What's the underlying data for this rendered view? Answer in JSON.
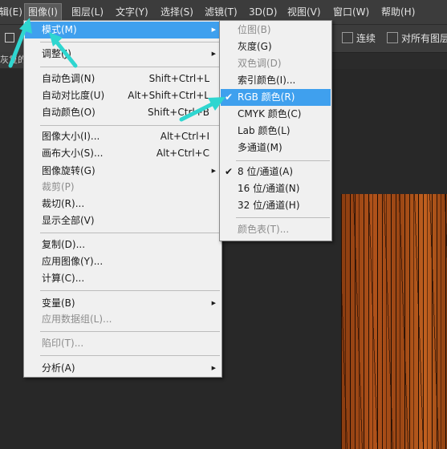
{
  "menubar": {
    "items": [
      {
        "label": "辑(E)"
      },
      {
        "label": "图像(I)"
      },
      {
        "label": "图层(L)"
      },
      {
        "label": "文字(Y)"
      },
      {
        "label": "选择(S)"
      },
      {
        "label": "滤镜(T)"
      },
      {
        "label": "3D(D)"
      },
      {
        "label": "视图(V)"
      },
      {
        "label": "窗口(W)"
      },
      {
        "label": "帮助(H)"
      }
    ]
  },
  "options": {
    "contiguous_label": "连续",
    "all_layers_label": "对所有图层"
  },
  "document": {
    "tab_text": "灰复的"
  },
  "image_menu": {
    "items": [
      {
        "label": "模式(M)",
        "has_submenu": true,
        "highlighted": true
      },
      {
        "label": "调整(J)",
        "has_submenu": true
      },
      {
        "label": "自动色调(N)",
        "shortcut": "Shift+Ctrl+L"
      },
      {
        "label": "自动对比度(U)",
        "shortcut": "Alt+Shift+Ctrl+L"
      },
      {
        "label": "自动颜色(O)",
        "shortcut": "Shift+Ctrl+B"
      },
      {
        "label": "图像大小(I)...",
        "shortcut": "Alt+Ctrl+I"
      },
      {
        "label": "画布大小(S)...",
        "shortcut": "Alt+Ctrl+C"
      },
      {
        "label": "图像旋转(G)",
        "has_submenu": true
      },
      {
        "label": "裁剪(P)",
        "disabled": true
      },
      {
        "label": "裁切(R)..."
      },
      {
        "label": "显示全部(V)"
      },
      {
        "label": "复制(D)..."
      },
      {
        "label": "应用图像(Y)..."
      },
      {
        "label": "计算(C)..."
      },
      {
        "label": "变量(B)",
        "has_submenu": true
      },
      {
        "label": "应用数据组(L)...",
        "disabled": true
      },
      {
        "label": "陷印(T)...",
        "disabled": true
      },
      {
        "label": "分析(A)",
        "has_submenu": true
      }
    ]
  },
  "mode_submenu": {
    "items": [
      {
        "label": "位图(B)",
        "disabled": true
      },
      {
        "label": "灰度(G)"
      },
      {
        "label": "双色调(D)",
        "disabled": true
      },
      {
        "label": "索引颜色(I)..."
      },
      {
        "label": "RGB 颜色(R)",
        "checked": true,
        "highlighted": true
      },
      {
        "label": "CMYK 颜色(C)"
      },
      {
        "label": "Lab 颜色(L)"
      },
      {
        "label": "多通道(M)"
      },
      {
        "label": "8 位/通道(A)",
        "checked": true
      },
      {
        "label": "16 位/通道(N)"
      },
      {
        "label": "32 位/通道(H)"
      },
      {
        "label": "颜色表(T)...",
        "disabled": true
      }
    ]
  },
  "icons": {
    "submenu_arrow": "▶",
    "check": "✔"
  },
  "colors": {
    "highlight": "#3fa0ee",
    "annotation_arrow": "#2fd6d0",
    "menubar_bg": "#3c3c3c",
    "menu_bg": "#f0f0f0"
  }
}
